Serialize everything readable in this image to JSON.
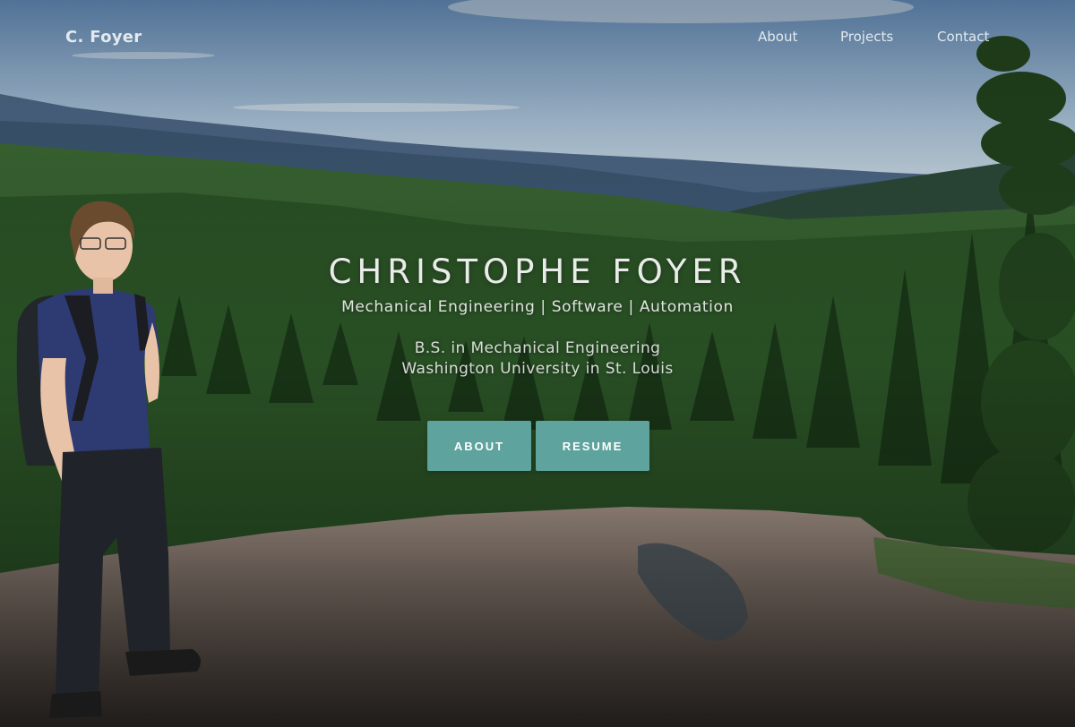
{
  "nav": {
    "brand": "C. Foyer",
    "links": [
      {
        "label": "About"
      },
      {
        "label": "Projects"
      },
      {
        "label": "Contact"
      }
    ]
  },
  "hero": {
    "name": "CHRISTOPHE FOYER",
    "tagline": "Mechanical Engineering | Software | Automation",
    "degree": "B.S. in Mechanical Engineering",
    "school": "Washington University in St. Louis",
    "buttons": [
      {
        "label": "ABOUT"
      },
      {
        "label": "RESUME"
      }
    ],
    "accent_color": "#5fa39e"
  }
}
